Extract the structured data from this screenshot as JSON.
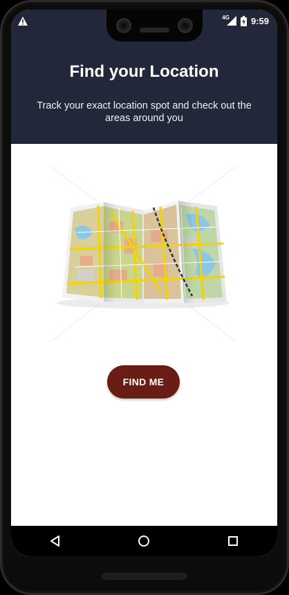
{
  "status_bar": {
    "time": "9:59",
    "network": "4G",
    "alert_icon": "warning-icon",
    "signal_icon": "signal-icon",
    "battery_icon": "battery-charging-icon"
  },
  "header": {
    "title": "Find your Location",
    "subtitle": "Track your exact location spot and check out the areas around you",
    "background": "#222839"
  },
  "illustration": {
    "icon": "folded-map-illustration"
  },
  "actions": {
    "find_me_label": "FIND ME",
    "button_color": "#6a1d14"
  },
  "nav": {
    "back_icon": "back-triangle-icon",
    "home_icon": "home-circle-icon",
    "recents_icon": "recents-square-icon"
  }
}
